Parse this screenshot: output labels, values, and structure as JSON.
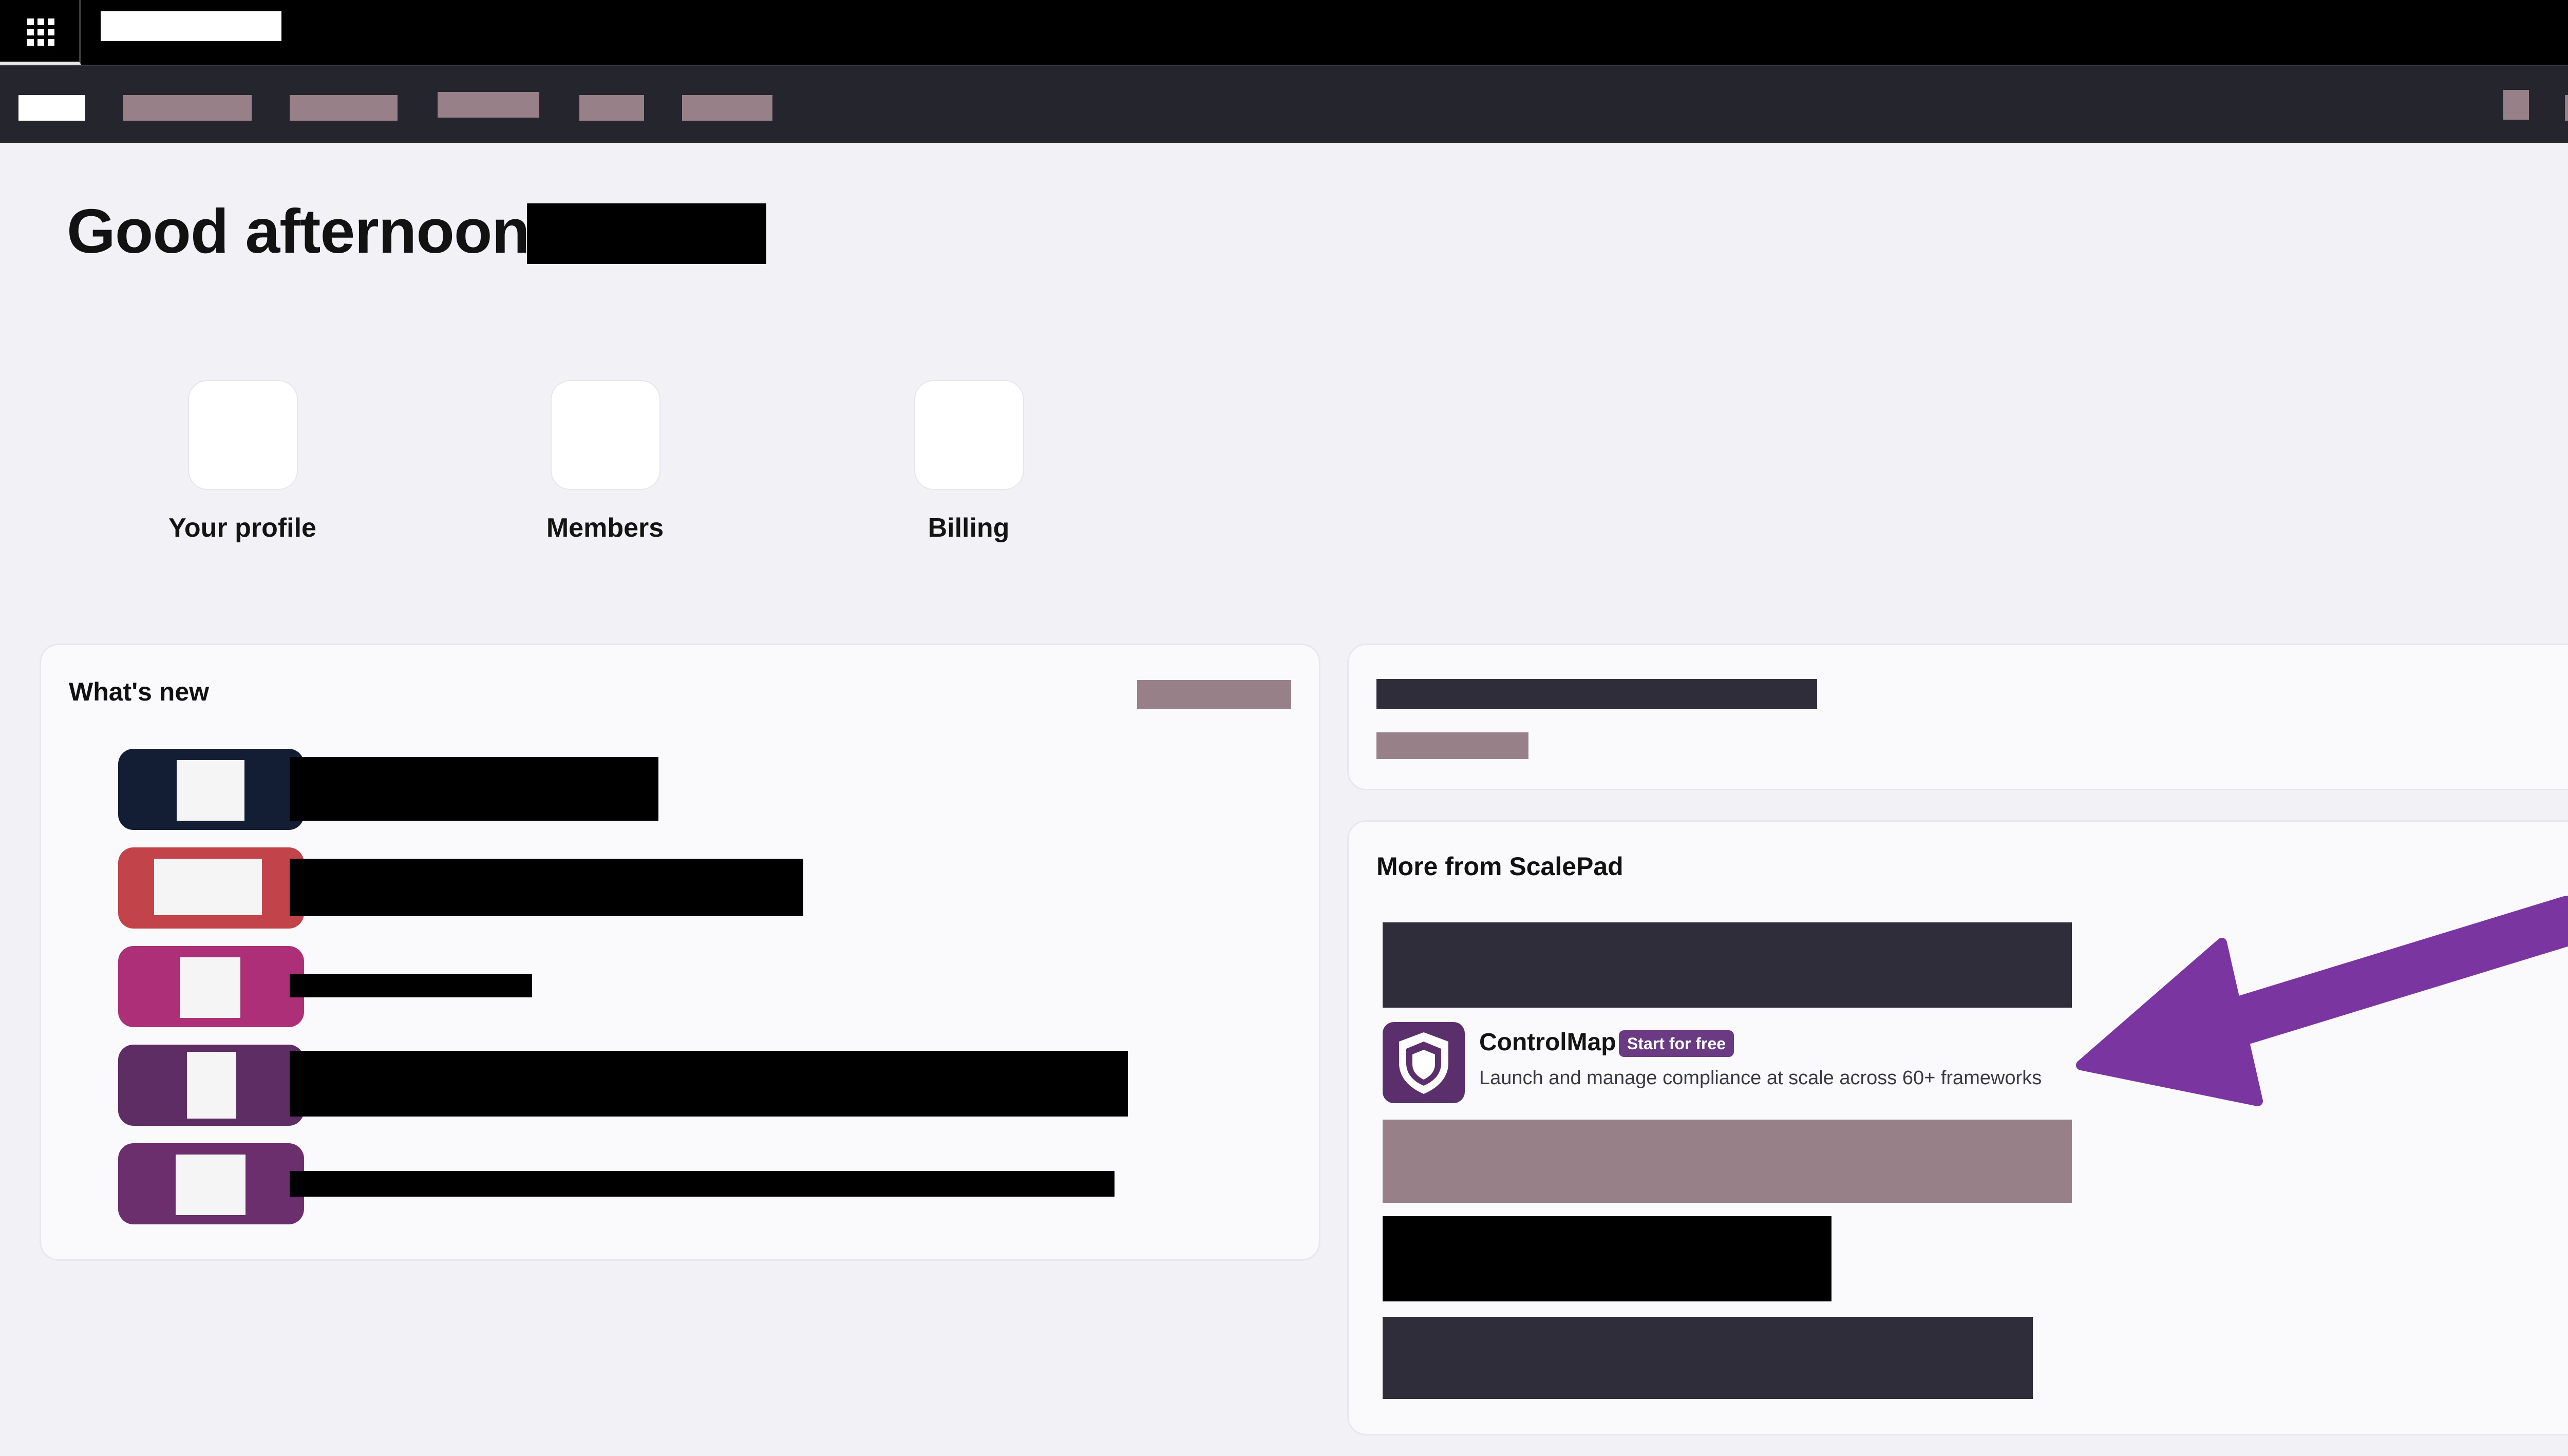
{
  "greeting": {
    "text": "Good afternoon,"
  },
  "quick_links": [
    {
      "label": "Your profile"
    },
    {
      "label": "Members"
    },
    {
      "label": "Billing"
    }
  ],
  "whats_new": {
    "title": "What's new"
  },
  "more_from": {
    "title": "More from ScalePad",
    "featured": {
      "name": "ControlMap",
      "badge": "Start for free",
      "description": "Launch and manage compliance at scale across 60+ frameworks",
      "icon": "shield-icon"
    }
  },
  "colors": {
    "topbar": "#000000",
    "navbar": "#25252e",
    "background": "#f2f2f6",
    "accent_purple": "#7a35a0",
    "badge_purple": "#6a3a82",
    "redaction_mauve": "#978087",
    "redaction_dark": "#302d3a"
  }
}
